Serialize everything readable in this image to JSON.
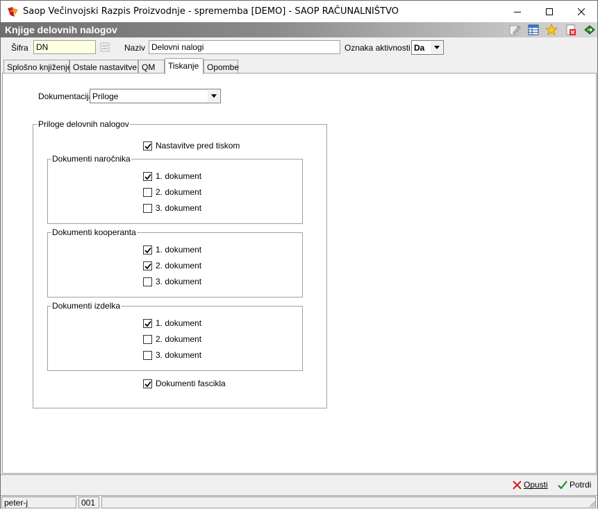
{
  "window": {
    "title": "Saop  Večinvojski Razpis Proizvodnje - sprememba [DEMO] - SAOP RAČUNALNIŠTVO"
  },
  "header": {
    "title": "Knjige delovnih nalogov",
    "icons": [
      "edit-icon",
      "table-icon",
      "star-icon",
      "delete-icon",
      "export-icon"
    ]
  },
  "fields": {
    "sifra_label": "Šifra",
    "sifra_value": "DN",
    "naziv_label": "Naziv",
    "naziv_value": "Delovni nalogi",
    "aktivnost_label": "Oznaka aktivnosti",
    "aktivnost_value": "Da"
  },
  "tabs": [
    {
      "label": "Splošno knjiženje",
      "active": false
    },
    {
      "label": "Ostale nastavitve",
      "active": false
    },
    {
      "label": "QM",
      "active": false
    },
    {
      "label": "Tiskanje",
      "active": true
    },
    {
      "label": "Opombe",
      "active": false
    }
  ],
  "print": {
    "dokumentacija_label": "Dokumentacija",
    "dokumentacija_value": "Priloge",
    "group_title": "Priloge delovnih nalogov",
    "nastavitve": {
      "label": "Nastavitve pred tiskom",
      "checked": true
    },
    "narocnik": {
      "title": "Dokumenti naročnika",
      "items": [
        {
          "label": "1. dokument",
          "checked": true
        },
        {
          "label": "2. dokument",
          "checked": false
        },
        {
          "label": "3. dokument",
          "checked": false
        }
      ]
    },
    "kooperant": {
      "title": "Dokumenti kooperanta",
      "items": [
        {
          "label": "1. dokument",
          "checked": true
        },
        {
          "label": "2. dokument",
          "checked": true
        },
        {
          "label": "3. dokument",
          "checked": false
        }
      ]
    },
    "izdelek": {
      "title": "Dokumenti izdelka",
      "items": [
        {
          "label": "1. dokument",
          "checked": true
        },
        {
          "label": "2. dokument",
          "checked": false
        },
        {
          "label": "3. dokument",
          "checked": false
        }
      ]
    },
    "fascikla": {
      "label": "Dokumenti fascikla",
      "checked": true
    }
  },
  "actions": {
    "opusti_label": "Opusti",
    "potrdi_label": "Potrdi"
  },
  "status": {
    "user": "peter-j",
    "code": "001"
  },
  "colors": {
    "header_dark": "#6f6f6f",
    "input_yellow": "#ffffe1",
    "cancel_red": "#d11a1a",
    "confirm_green": "#1e8a1e"
  }
}
